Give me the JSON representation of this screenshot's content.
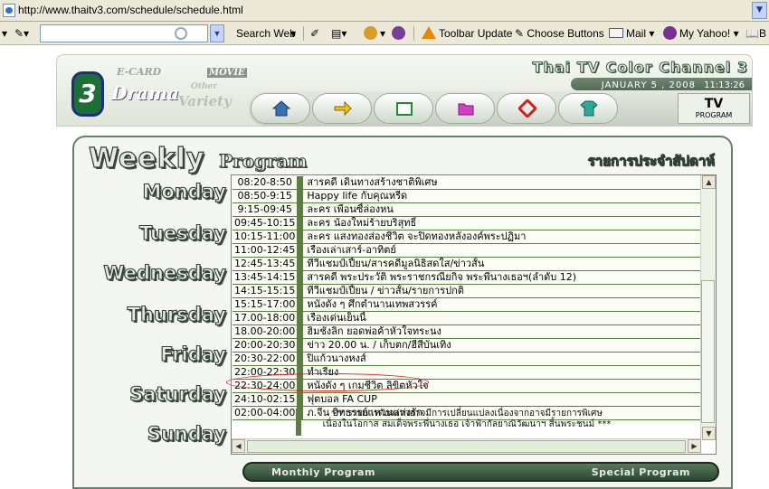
{
  "browser": {
    "url": "http://www.thaitv3.com/schedule/schedule.html",
    "toolbar": {
      "search_web": "Search Web",
      "toolbar_update": "Toolbar Update",
      "choose_buttons": "Choose Buttons",
      "mail": "Mail",
      "my_yahoo": "My Yahoo!",
      "overflow": "B"
    }
  },
  "site": {
    "channel_title": "Thai TV Color Channel 3",
    "date": "JANUARY  5 , 2008",
    "time": "11:13:26",
    "left_panel": {
      "ecard": "E-CARD",
      "movie": "MOVIE",
      "drama": "Drama",
      "other": "Other",
      "variety": "Variety"
    },
    "tv_program": {
      "line1": "TV",
      "line2": "PROGRAM"
    },
    "logo_text": "3",
    "nav_icons": [
      "home-icon",
      "arrow-icon",
      "window-icon",
      "folder-icon",
      "diamond-icon",
      "shirt-icon"
    ]
  },
  "panel": {
    "weekly": "Weekly",
    "program": "Program",
    "thai_title": "รายการประจำสัปดาห์",
    "days": [
      "Monday",
      "Tuesday",
      "Wednesday",
      "Thursday",
      "Friday",
      "Saturday",
      "Sunday"
    ]
  },
  "schedule": [
    {
      "time": "08:20-8:50",
      "program": "สารคดี เดินทางสร้างชาติพิเศษ"
    },
    {
      "time": "08:50-9:15",
      "program": "Happy life กับคุณหรีด"
    },
    {
      "time": "9:15-09:45",
      "program": "ละคร เพื่อนซี้ล่องหน"
    },
    {
      "time": "09:45-10:15",
      "program": "ละคร น้องใหม่ร้ายบริสุทธิ์"
    },
    {
      "time": "10:15-11:00",
      "program": "ละคร แสงทองส่องชีวิต จะปิดทองหลังองค์พระปฏิมา"
    },
    {
      "time": "11:00-12:45",
      "program": "เรื่องเล่าเสาร์-อาทิตย์"
    },
    {
      "time": "12:45-13:45",
      "program": "ทีวีแชมป์เปี้ยน/สารคดีมูลนิธิสดใส/ข่าวสั้น"
    },
    {
      "time": "13:45-14:15",
      "program": "สารคดี พระประวัติ พระราชกรณียกิจ พระพี่นางเธอฯ(ลำดับ 12)"
    },
    {
      "time": "14:15-15:15",
      "program": "ทีวีแชมป์เปี้ยน / ข่าวสั้น/รายการปกติ"
    },
    {
      "time": "15:15-17:00",
      "program": "หนังดัง ๆ ศึกตำนานเทพสวรรค์"
    },
    {
      "time": "17.00-18:00",
      "program": "เรื่องเด่นเย็นนี้"
    },
    {
      "time": "18.00-20:00",
      "program": "ฮิมชั่งลิก ยอดพ่อค้าหัวใจทระนง"
    },
    {
      "time": "20:00-20:30",
      "program": "ข่าว 20.00 น. / เก็บตก/ฮีสีบันเทิง"
    },
    {
      "time": "20:30-22:00",
      "program": "ปิแก้วนางหงส์"
    },
    {
      "time": "22:00-22:30",
      "program": "ทำเรียง"
    },
    {
      "time": "22:30-24:00",
      "program": "หนังดัง ๆ เกมชีวิต ลิขิตหัวใจ"
    },
    {
      "time": "24:10-02:15",
      "program": "ฟุตบอล FA CUP"
    },
    {
      "time": "02:00-04:00",
      "program": "ภ.จีน อิทธรรย์แหวนแห่งรัก"
    }
  ],
  "note": {
    "line1": "*** รายการดังกล่าวอาจมีการเปลี่ยนแปลงเนื่องจากอาจมีรายการพิเศษ",
    "line2": "เนื่องในโอกาส สมเด็จพระพี่นางเธอ เจ้าฟ้ากัลยาณิวัฒนาฯ สิ้นพระชนม์ ***"
  },
  "bottom": {
    "monthly": "Monthly Program",
    "special": "Special Program"
  },
  "colors": {
    "row_border": "#5d7d45",
    "highlight_circle": "#d8231a"
  }
}
